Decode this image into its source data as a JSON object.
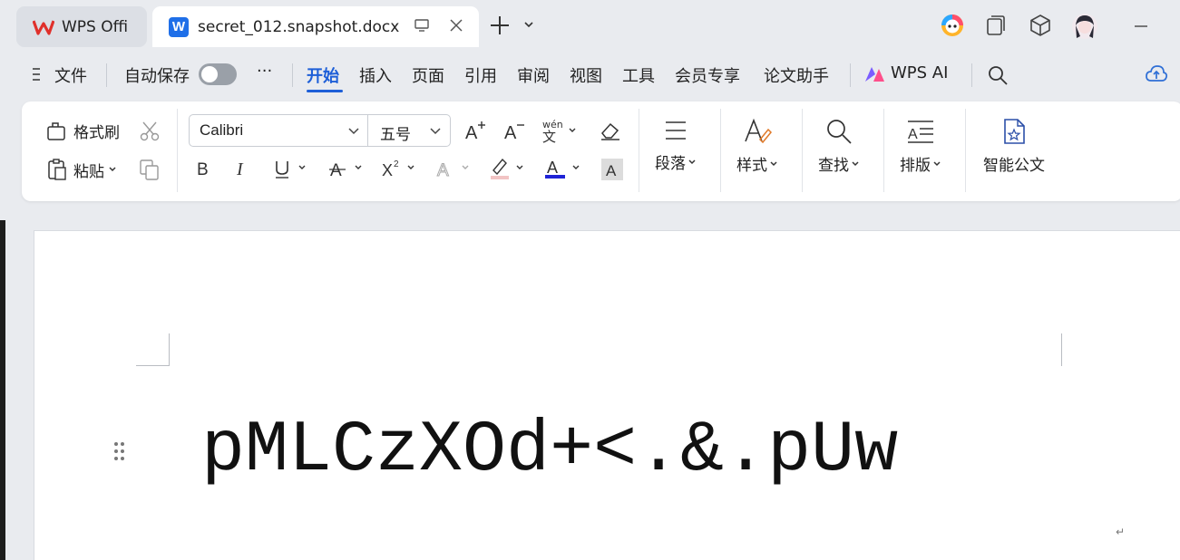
{
  "titlebar": {
    "home_tab": "WPS Offi",
    "doc_tab": "secret_012.snapshot.docx"
  },
  "menu": {
    "file": "文件",
    "autosave": "自动保存",
    "more": "···",
    "tabs": [
      "开始",
      "插入",
      "页面",
      "引用",
      "审阅",
      "视图",
      "工具",
      "会员专享",
      "论文助手"
    ],
    "wps_ai": "WPS AI"
  },
  "ribbon": {
    "format_painter": "格式刷",
    "paste": "粘贴",
    "font_name": "Calibri",
    "font_size": "五号",
    "paragraph": "段落",
    "styles": "样式",
    "find": "查找",
    "layout": "排版",
    "smart_doc": "智能公文",
    "font_color": "#1f23d6"
  },
  "document": {
    "text": "pMLCzXOd+<.&.pUw"
  }
}
